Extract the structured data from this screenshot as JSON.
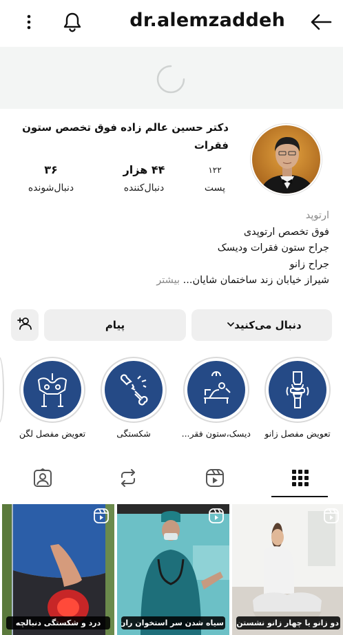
{
  "header": {
    "username": "dr.alemzaddeh"
  },
  "profile": {
    "display_name": "دکتر حسین عالم زاده فوق تخصص ستون فقرات",
    "stats": {
      "posts_count": "۱۲۲",
      "posts_label": "پست",
      "followers_count": "۴۴ هزار",
      "followers_label": "دنبال‌کننده",
      "following_count": "۳۶",
      "following_label": "دنبال‌شونده"
    },
    "bio": {
      "category": "ارتوپد",
      "lines": [
        "فوق تخصص ارتوپدی",
        "جراح ستون فقرات ودیسک",
        "جراح زانو",
        "شیراز خیابان زند ساختمان شایان..."
      ],
      "more_label": "بیشتر"
    }
  },
  "actions": {
    "follow_label": "دنبال می‌کنید",
    "message_label": "پیام"
  },
  "highlights": [
    {
      "label": "تعویض مفصل زانو",
      "icon": "knee-joint-icon"
    },
    {
      "label": "دیسک،ستون فقر...",
      "icon": "spine-surgery-icon"
    },
    {
      "label": "شکستگی",
      "icon": "broken-bone-icon"
    },
    {
      "label": "تعویض مفصل لگن",
      "icon": "pelvis-icon"
    }
  ],
  "tabs": [
    {
      "name": "grid",
      "icon": "grid-icon",
      "active": true
    },
    {
      "name": "reels",
      "icon": "reels-icon",
      "active": false
    },
    {
      "name": "reposts",
      "icon": "repost-icon",
      "active": false
    },
    {
      "name": "tagged",
      "icon": "tagged-icon",
      "active": false
    }
  ],
  "posts": [
    {
      "caption": "دو زانو یا چهار زانو نشستن"
    },
    {
      "caption": "سیاه شدن سر استخوان ران"
    },
    {
      "caption": "درد و شکستگی دنبالچه"
    }
  ],
  "colors": {
    "highlight_bg": "#254a86",
    "button_bg": "#efefef",
    "muted_text": "#8a8a8a"
  }
}
